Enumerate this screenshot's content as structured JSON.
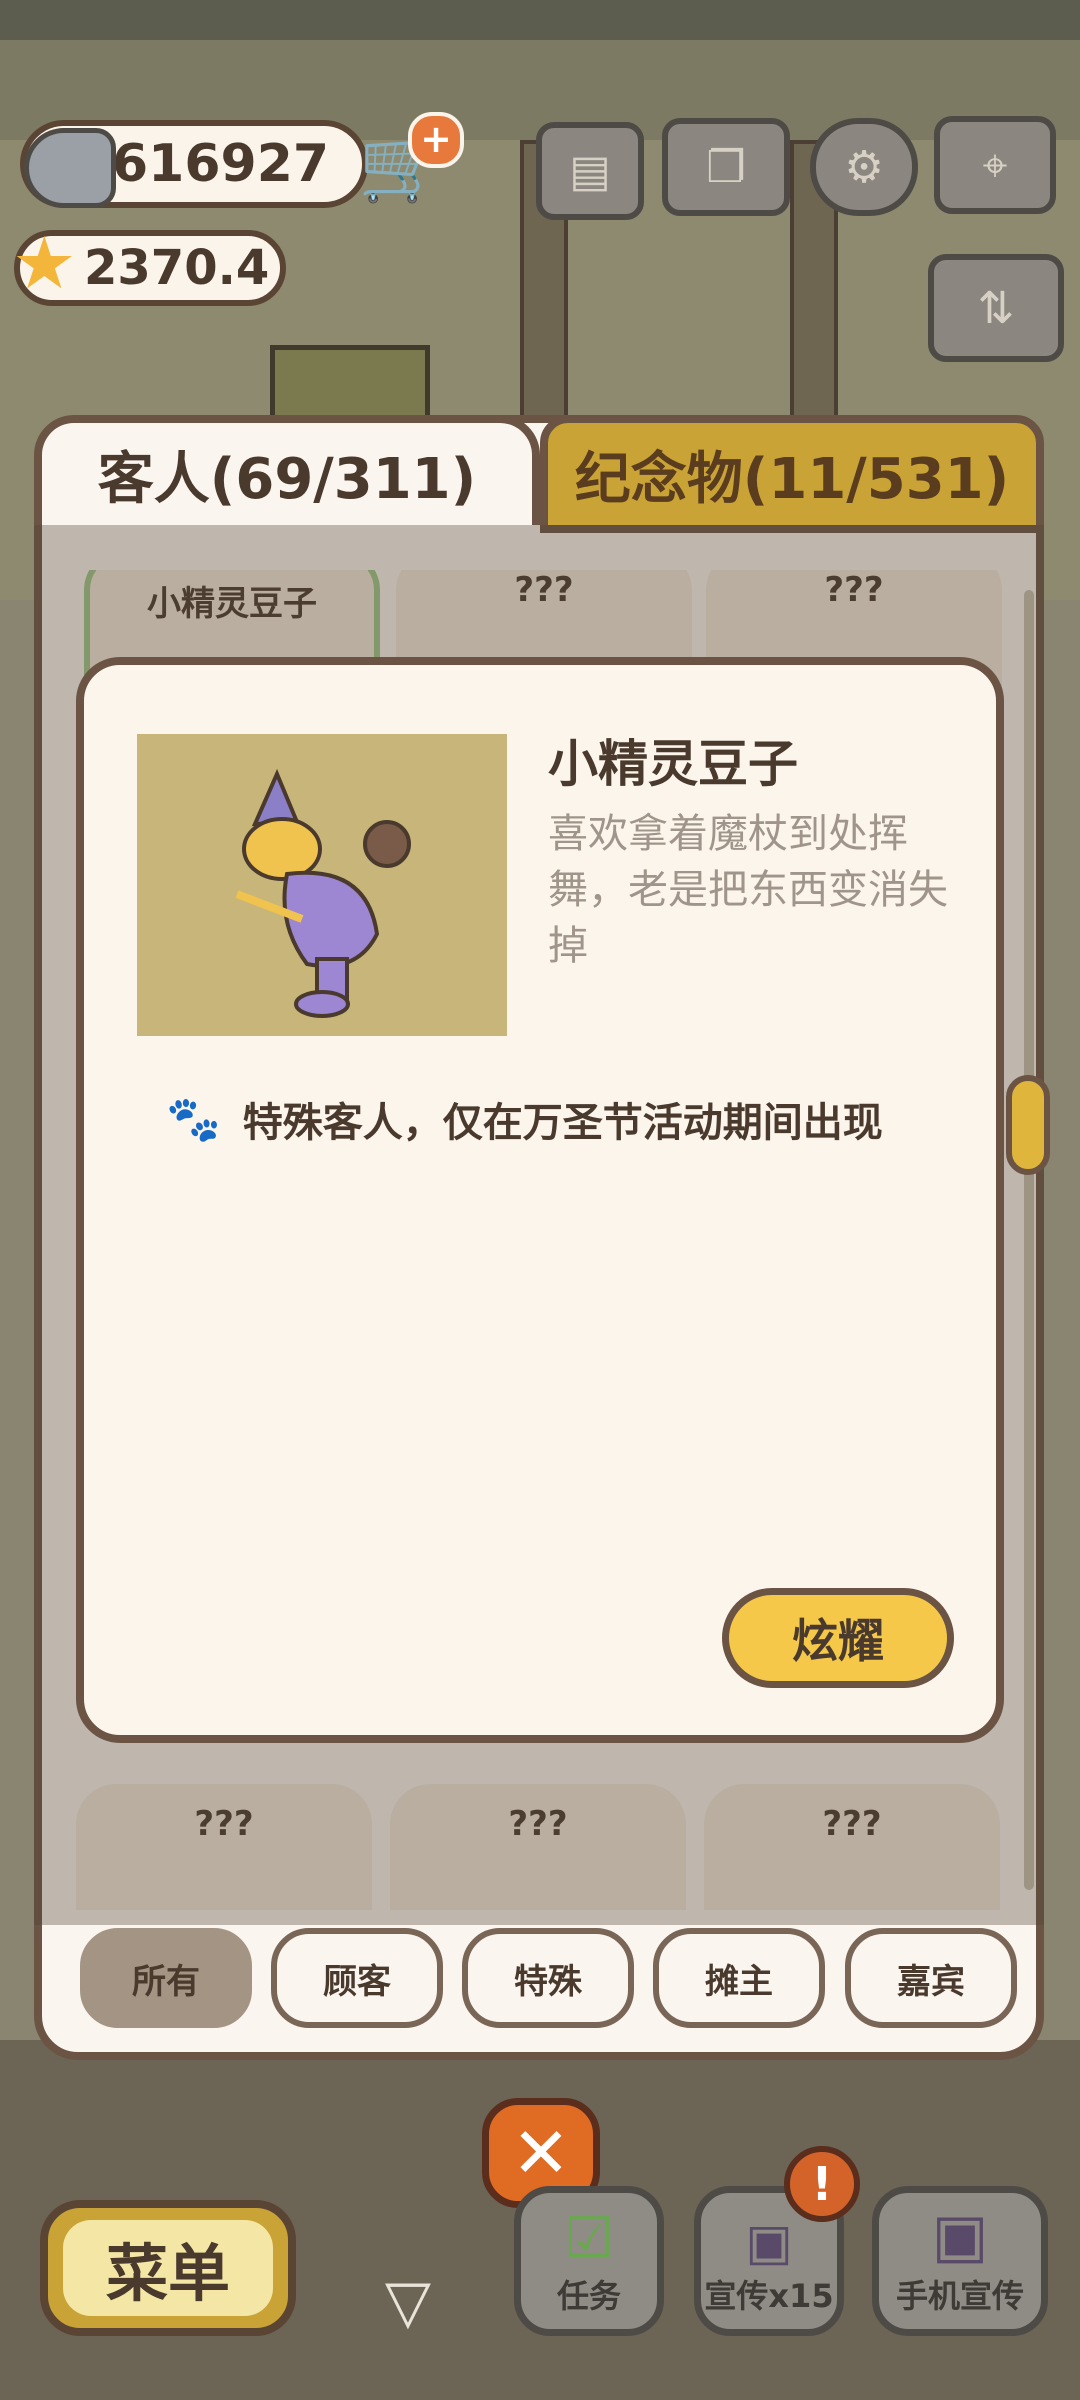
{
  "hud": {
    "fish_currency": "616927",
    "star_currency": "2370.4",
    "icons": [
      "fish-icon",
      "cart-add-icon",
      "star-icon",
      "card-icon",
      "book-icon",
      "gear-icon",
      "map-icon",
      "sort-icon"
    ]
  },
  "tabs": [
    {
      "label": "客人(69/311)",
      "active": true
    },
    {
      "label": "纪念物(11/531)",
      "active": false
    }
  ],
  "grid": {
    "top_row": [
      {
        "label": "小精灵豆子"
      },
      {
        "label": "???"
      },
      {
        "label": "???"
      }
    ],
    "bottom_row": [
      {
        "label": "???"
      },
      {
        "label": "???"
      },
      {
        "label": "???"
      }
    ]
  },
  "modal": {
    "name": "小精灵豆子",
    "description": "喜欢拿着魔杖到处挥舞，老是把东西变消失掉",
    "note": "特殊客人，仅在万圣节活动期间出现",
    "show_button": "炫耀",
    "colors": {
      "portrait_bg": "#c8b579",
      "button": "#f6c84a"
    }
  },
  "filters": [
    {
      "label": "所有",
      "active": true
    },
    {
      "label": "顾客",
      "active": false
    },
    {
      "label": "特殊",
      "active": false
    },
    {
      "label": "摊主",
      "active": false
    },
    {
      "label": "嘉宾",
      "active": false
    }
  ],
  "bottom_bar": {
    "menu": "菜单",
    "task": "任务",
    "promo": "宣传x15",
    "phone_promo": "手机宣传",
    "alert": "!",
    "close": "✕"
  }
}
